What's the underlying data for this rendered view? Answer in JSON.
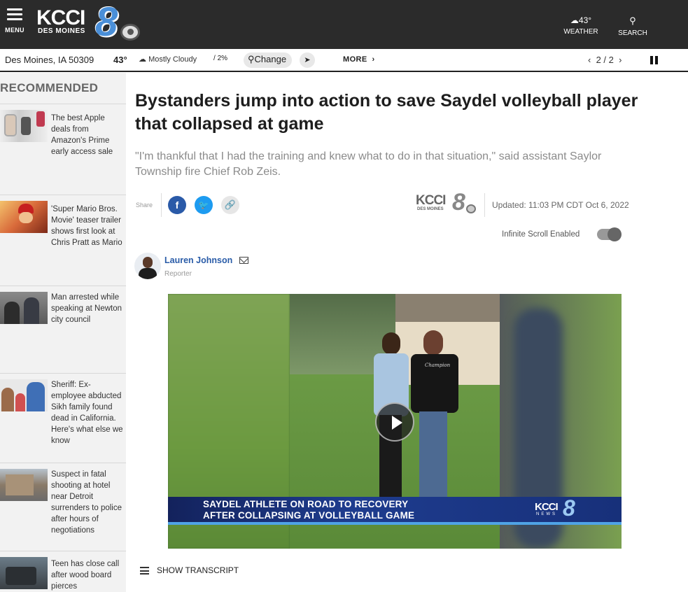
{
  "header": {
    "menu_label": "MENU",
    "logo_text": "KCCI",
    "logo_sub": "DES MOINES",
    "logo_channel": "8",
    "weather_temp": "43°",
    "weather_label": "WEATHER",
    "search_label": "SEARCH"
  },
  "location_bar": {
    "city": "Des Moines, IA 50309",
    "temp": "43°",
    "condition": "Mostly Cloudy",
    "precip": "2%",
    "change_label": "Change",
    "more_label": "MORE",
    "pager": "2 / 2"
  },
  "sidebar": {
    "heading": "RECOMMENDED",
    "items": [
      {
        "title": "The best Apple deals from Amazon's Prime early access sale"
      },
      {
        "title": "'Super Mario Bros. Movie' teaser trailer shows first look at Chris Pratt as Mario"
      },
      {
        "title": "Man arrested while speaking at Newton city council"
      },
      {
        "title": "Sheriff: Ex-employee abducted Sikh family found dead in California. Here's what else we know"
      },
      {
        "title": "Suspect in fatal shooting at hotel near Detroit surrenders to police after hours of negotiations"
      },
      {
        "title": "Teen has close call after wood board pierces"
      }
    ]
  },
  "article": {
    "headline": "Bystanders jump into action to save Saydel volleyball player that collapsed at game",
    "subhead": "\"I'm thankful that I had the training and knew what to do in that situation,\" said assistant Saylor Township fire Chief Rob Zeis.",
    "share_label": "Share",
    "updated": "Updated: 11:03 PM CDT Oct 6, 2022",
    "infinite_scroll_label": "Infinite Scroll Enabled",
    "author_name": "Lauren Johnson",
    "author_role": "Reporter",
    "source_logo_text": "KCCI",
    "source_logo_sub": "DES MOINES",
    "source_logo_channel": "8"
  },
  "video": {
    "lower_third_line1": "SAYDEL ATHLETE ON ROAD TO RECOVERY",
    "lower_third_line2": "AFTER COLLAPSING AT VOLLEYBALL GAME",
    "logo_text": "KCCI",
    "logo_sub": "NEWS",
    "logo_channel": "8",
    "shirt_text": "Champion",
    "transcript_label": "SHOW TRANSCRIPT"
  },
  "icons": {
    "menu": "hamburger-icon",
    "weather": "partly-cloudy-icon",
    "search": "magnifier-icon",
    "location": "pin-icon",
    "locate": "arrow-icon",
    "facebook": "facebook-icon",
    "twitter": "twitter-icon",
    "link": "link-icon",
    "mail": "envelope-icon",
    "play": "play-icon"
  },
  "colors": {
    "header_bg": "#2b2b2b",
    "author_link": "#2a5ca8",
    "facebook": "#2a5aa8",
    "twitter": "#1d9bf0",
    "lower_third": "#1e3c8e"
  }
}
